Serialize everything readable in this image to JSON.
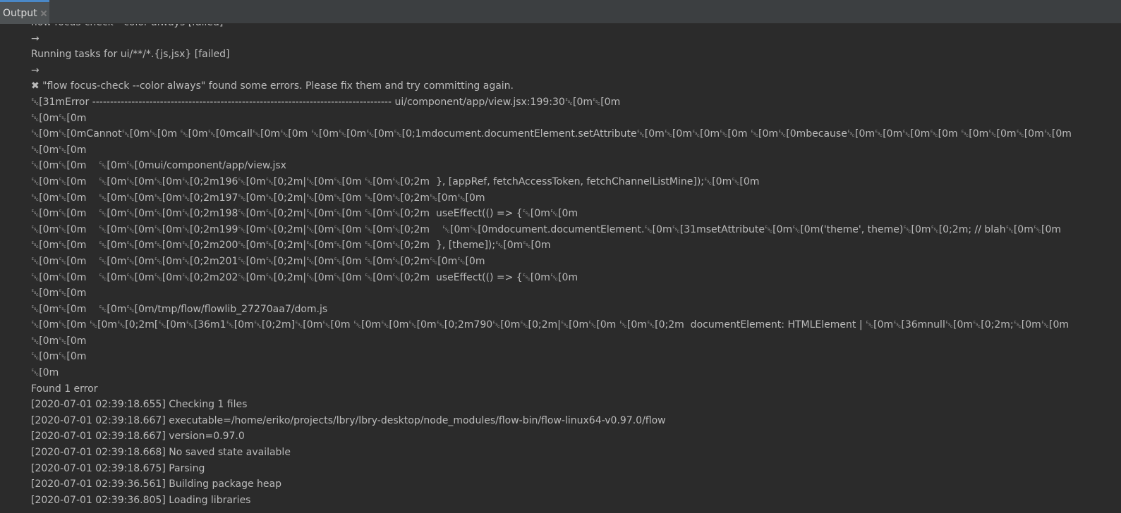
{
  "tab": {
    "label": "Output",
    "close_icon": "close-icon"
  },
  "lines": [
    "flow focus-check --color always [failed]",
    "→",
    "Running tasks for ui/**/*.{js,jsx} [failed]",
    "→",
    "✖ \"flow focus-check --color always\" found some errors. Please fix them and try committing again.",
    "␛[31mError ------------------------------------------------------------------------------------ ui/component/app/view.jsx:199:30␛[0m␛[0m",
    "␛[0m␛[0m",
    "␛[0m␛[0mCannot␛[0m␛[0m ␛[0m␛[0mcall␛[0m␛[0m ␛[0m␛[0m␛[0m␛[0;1mdocument.documentElement.setAttribute␛[0m␛[0m␛[0m␛[0m ␛[0m␛[0mbecause␛[0m␛[0m␛[0m␛[0m ␛[0m␛[0m␛[0m␛[0m",
    "␛[0m␛[0m",
    "␛[0m␛[0m    ␛[0m␛[0mui/component/app/view.jsx",
    "␛[0m␛[0m    ␛[0m␛[0m␛[0m␛[0;2m196␛[0m␛[0;2m|␛[0m␛[0m ␛[0m␛[0;2m  }, [appRef, fetchAccessToken, fetchChannelListMine]);␛[0m␛[0m",
    "␛[0m␛[0m    ␛[0m␛[0m␛[0m␛[0;2m197␛[0m␛[0;2m|␛[0m␛[0m ␛[0m␛[0;2m␛[0m␛[0m",
    "␛[0m␛[0m    ␛[0m␛[0m␛[0m␛[0;2m198␛[0m␛[0;2m|␛[0m␛[0m ␛[0m␛[0;2m  useEffect(() => {␛[0m␛[0m",
    "␛[0m␛[0m    ␛[0m␛[0m␛[0m␛[0;2m199␛[0m␛[0;2m|␛[0m␛[0m ␛[0m␛[0;2m    ␛[0m␛[0mdocument.documentElement.␛[0m␛[31msetAttribute␛[0m␛[0m('theme', theme)␛[0m␛[0;2m; // blah␛[0m␛[0m",
    "␛[0m␛[0m    ␛[0m␛[0m␛[0m␛[0;2m200␛[0m␛[0;2m|␛[0m␛[0m ␛[0m␛[0;2m  }, [theme]);␛[0m␛[0m",
    "␛[0m␛[0m    ␛[0m␛[0m␛[0m␛[0;2m201␛[0m␛[0;2m|␛[0m␛[0m ␛[0m␛[0;2m␛[0m␛[0m",
    "␛[0m␛[0m    ␛[0m␛[0m␛[0m␛[0;2m202␛[0m␛[0;2m|␛[0m␛[0m ␛[0m␛[0;2m  useEffect(() => {␛[0m␛[0m",
    "␛[0m␛[0m",
    "␛[0m␛[0m    ␛[0m␛[0m/tmp/flow/flowlib_27270aa7/dom.js",
    "␛[0m␛[0m ␛[0m␛[0;2m[␛[0m␛[36m1␛[0m␛[0;2m]␛[0m␛[0m ␛[0m␛[0m␛[0m␛[0;2m790␛[0m␛[0;2m|␛[0m␛[0m ␛[0m␛[0;2m  documentElement: HTMLElement | ␛[0m␛[36mnull␛[0m␛[0;2m;␛[0m␛[0m",
    "␛[0m␛[0m",
    "␛[0m␛[0m",
    "␛[0m",
    "Found 1 error",
    "[2020-07-01 02:39:18.655] Checking 1 files",
    "[2020-07-01 02:39:18.667] executable=/home/eriko/projects/lbry/lbry-desktop/node_modules/flow-bin/flow-linux64-v0.97.0/flow",
    "[2020-07-01 02:39:18.667] version=0.97.0",
    "[2020-07-01 02:39:18.668] No saved state available",
    "[2020-07-01 02:39:18.675] Parsing",
    "[2020-07-01 02:39:36.561] Building package heap",
    "[2020-07-01 02:39:36.805] Loading libraries"
  ]
}
